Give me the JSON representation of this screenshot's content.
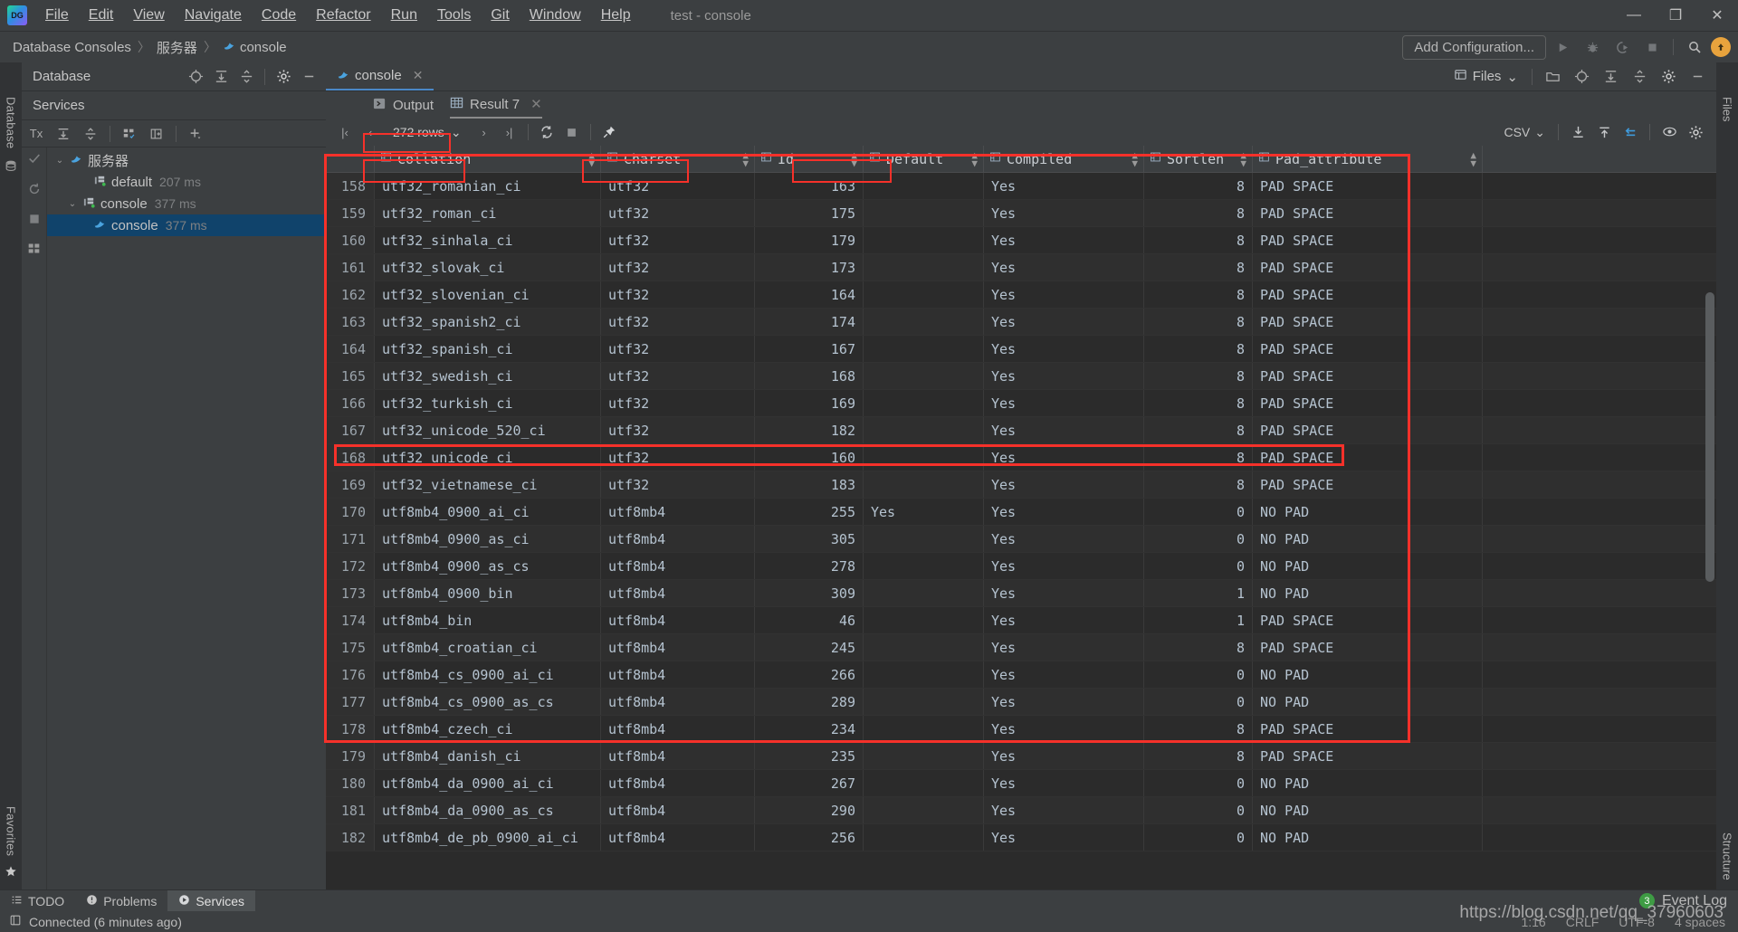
{
  "app": {
    "logo_text": "DG",
    "window_title": "test - console"
  },
  "menu": [
    {
      "label": "File"
    },
    {
      "label": "Edit"
    },
    {
      "label": "View"
    },
    {
      "label": "Navigate"
    },
    {
      "label": "Code"
    },
    {
      "label": "Refactor"
    },
    {
      "label": "Run"
    },
    {
      "label": "Tools"
    },
    {
      "label": "Git"
    },
    {
      "label": "Window"
    },
    {
      "label": "Help"
    }
  ],
  "window_controls": {
    "minimize": "—",
    "maximize": "❐",
    "close": "✕"
  },
  "breadcrumb": {
    "items": [
      {
        "label": "Database Consoles",
        "icon": ""
      },
      {
        "label": "服务器",
        "icon": ""
      },
      {
        "label": "console",
        "icon": "dolphin-icon"
      }
    ],
    "separator": "〉"
  },
  "run_toolbar": {
    "add_configuration": "Add Configuration...",
    "icons": [
      "run-icon",
      "debug-icon",
      "run-with-coverage-icon",
      "stop-icon",
      "search-icon",
      "update-icon"
    ]
  },
  "left_rail": {
    "label": "Database",
    "icon": "database-icon",
    "bottom_label": "Favorites",
    "bottom_icon": "star-icon"
  },
  "database_panel": {
    "title": "Database",
    "icons": [
      "locate-icon",
      "expand-all-icon",
      "collapse-all-icon",
      "settings-icon",
      "hide-icon"
    ]
  },
  "services_panel": {
    "title": "Services",
    "icons": [
      "settings-icon",
      "hide-icon"
    ],
    "toolbar": [
      "Tx",
      "expand-all-icon",
      "collapse-all-icon",
      "group-icon",
      "new-tab-icon",
      "add-icon"
    ],
    "gutter_icons": [
      "commit-icon",
      "rollback-icon",
      "stop-icon",
      "grid-icon"
    ]
  },
  "tree": [
    {
      "label": "服务器",
      "ms": "",
      "indent": 0,
      "chevron": "⌄",
      "icon": "dolphin-icon",
      "selected": false
    },
    {
      "label": "default",
      "ms": "207 ms",
      "indent": 1,
      "chevron": "",
      "icon": "console-icon",
      "selected": false
    },
    {
      "label": "console",
      "ms": "377 ms",
      "indent": 1,
      "chevron": "⌄",
      "icon": "console-icon",
      "selected": false
    },
    {
      "label": "console",
      "ms": "377 ms",
      "indent": 2,
      "chevron": "",
      "icon": "dolphin-icon",
      "selected": true
    }
  ],
  "editor": {
    "tab": {
      "label": "console",
      "icon": "dolphin-icon",
      "close": "✕"
    },
    "files_chip": {
      "label": "Files",
      "icon": "files-icon",
      "chevron": "⌄"
    },
    "right_icons": [
      "open-folder-icon",
      "locate-icon",
      "expand-icon",
      "collapse-icon",
      "settings-icon",
      "hide-icon"
    ]
  },
  "result_tabs": [
    {
      "label": "Output",
      "icon": "output-icon",
      "active": false,
      "closable": false
    },
    {
      "label": "Result 7",
      "icon": "table-icon",
      "active": true,
      "closable": true,
      "close": "✕"
    }
  ],
  "grid_toolbar": {
    "first_page": "|‹",
    "prev_page": "‹",
    "rows_label": "272 rows",
    "rows_chevron": "⌄",
    "next_page": "›",
    "last_page": "›|",
    "reload_icon": "refresh-icon",
    "stop_icon": "stop-icon",
    "pin_icon": "pin-icon",
    "format": "CSV",
    "format_chevron": "⌄",
    "right_icons": [
      "download-icon",
      "upload-icon",
      "transpose-icon",
      "view-icon",
      "settings-icon"
    ]
  },
  "grid": {
    "columns": [
      {
        "name": "Collation",
        "icon": "column-icon",
        "sortable": true,
        "width_class": "w-coll",
        "align": "left"
      },
      {
        "name": "Charset",
        "icon": "column-icon",
        "sortable": true,
        "width_class": "w-char",
        "align": "left"
      },
      {
        "name": "Id",
        "icon": "column-icon",
        "sortable": true,
        "width_class": "w-id",
        "align": "left"
      },
      {
        "name": "Default",
        "icon": "column-icon",
        "sortable": true,
        "width_class": "w-def",
        "align": "left"
      },
      {
        "name": "Compiled",
        "icon": "column-icon",
        "sortable": true,
        "width_class": "w-comp",
        "align": "left"
      },
      {
        "name": "Sortlen",
        "icon": "column-icon",
        "sortable": true,
        "width_class": "w-sort",
        "align": "left"
      },
      {
        "name": "Pad_attribute",
        "icon": "column-icon",
        "sortable": true,
        "width_class": "w-pad",
        "align": "left"
      }
    ],
    "rows": [
      {
        "n": "158",
        "collation": "utf32_romanian_ci",
        "charset": "utf32",
        "id": "163",
        "default": "",
        "compiled": "Yes",
        "sortlen": "8",
        "pad": "PAD SPACE",
        "highlight": false
      },
      {
        "n": "159",
        "collation": "utf32_roman_ci",
        "charset": "utf32",
        "id": "175",
        "default": "",
        "compiled": "Yes",
        "sortlen": "8",
        "pad": "PAD SPACE",
        "highlight": false
      },
      {
        "n": "160",
        "collation": "utf32_sinhala_ci",
        "charset": "utf32",
        "id": "179",
        "default": "",
        "compiled": "Yes",
        "sortlen": "8",
        "pad": "PAD SPACE",
        "highlight": false
      },
      {
        "n": "161",
        "collation": "utf32_slovak_ci",
        "charset": "utf32",
        "id": "173",
        "default": "",
        "compiled": "Yes",
        "sortlen": "8",
        "pad": "PAD SPACE",
        "highlight": false
      },
      {
        "n": "162",
        "collation": "utf32_slovenian_ci",
        "charset": "utf32",
        "id": "164",
        "default": "",
        "compiled": "Yes",
        "sortlen": "8",
        "pad": "PAD SPACE",
        "highlight": false
      },
      {
        "n": "163",
        "collation": "utf32_spanish2_ci",
        "charset": "utf32",
        "id": "174",
        "default": "",
        "compiled": "Yes",
        "sortlen": "8",
        "pad": "PAD SPACE",
        "highlight": false
      },
      {
        "n": "164",
        "collation": "utf32_spanish_ci",
        "charset": "utf32",
        "id": "167",
        "default": "",
        "compiled": "Yes",
        "sortlen": "8",
        "pad": "PAD SPACE",
        "highlight": false
      },
      {
        "n": "165",
        "collation": "utf32_swedish_ci",
        "charset": "utf32",
        "id": "168",
        "default": "",
        "compiled": "Yes",
        "sortlen": "8",
        "pad": "PAD SPACE",
        "highlight": false
      },
      {
        "n": "166",
        "collation": "utf32_turkish_ci",
        "charset": "utf32",
        "id": "169",
        "default": "",
        "compiled": "Yes",
        "sortlen": "8",
        "pad": "PAD SPACE",
        "highlight": false
      },
      {
        "n": "167",
        "collation": "utf32_unicode_520_ci",
        "charset": "utf32",
        "id": "182",
        "default": "",
        "compiled": "Yes",
        "sortlen": "8",
        "pad": "PAD SPACE",
        "highlight": false
      },
      {
        "n": "168",
        "collation": "utf32_unicode_ci",
        "charset": "utf32",
        "id": "160",
        "default": "",
        "compiled": "Yes",
        "sortlen": "8",
        "pad": "PAD SPACE",
        "highlight": false
      },
      {
        "n": "169",
        "collation": "utf32_vietnamese_ci",
        "charset": "utf32",
        "id": "183",
        "default": "",
        "compiled": "Yes",
        "sortlen": "8",
        "pad": "PAD SPACE",
        "highlight": false
      },
      {
        "n": "170",
        "collation": "utf8mb4_0900_ai_ci",
        "charset": "utf8mb4",
        "id": "255",
        "default": "Yes",
        "compiled": "Yes",
        "sortlen": "0",
        "pad": "NO PAD",
        "highlight": true
      },
      {
        "n": "171",
        "collation": "utf8mb4_0900_as_ci",
        "charset": "utf8mb4",
        "id": "305",
        "default": "",
        "compiled": "Yes",
        "sortlen": "0",
        "pad": "NO PAD",
        "highlight": false
      },
      {
        "n": "172",
        "collation": "utf8mb4_0900_as_cs",
        "charset": "utf8mb4",
        "id": "278",
        "default": "",
        "compiled": "Yes",
        "sortlen": "0",
        "pad": "NO PAD",
        "highlight": false
      },
      {
        "n": "173",
        "collation": "utf8mb4_0900_bin",
        "charset": "utf8mb4",
        "id": "309",
        "default": "",
        "compiled": "Yes",
        "sortlen": "1",
        "pad": "NO PAD",
        "highlight": false
      },
      {
        "n": "174",
        "collation": "utf8mb4_bin",
        "charset": "utf8mb4",
        "id": "46",
        "default": "",
        "compiled": "Yes",
        "sortlen": "1",
        "pad": "PAD SPACE",
        "highlight": false
      },
      {
        "n": "175",
        "collation": "utf8mb4_croatian_ci",
        "charset": "utf8mb4",
        "id": "245",
        "default": "",
        "compiled": "Yes",
        "sortlen": "8",
        "pad": "PAD SPACE",
        "highlight": false
      },
      {
        "n": "176",
        "collation": "utf8mb4_cs_0900_ai_ci",
        "charset": "utf8mb4",
        "id": "266",
        "default": "",
        "compiled": "Yes",
        "sortlen": "0",
        "pad": "NO PAD",
        "highlight": false
      },
      {
        "n": "177",
        "collation": "utf8mb4_cs_0900_as_cs",
        "charset": "utf8mb4",
        "id": "289",
        "default": "",
        "compiled": "Yes",
        "sortlen": "0",
        "pad": "NO PAD",
        "highlight": false
      },
      {
        "n": "178",
        "collation": "utf8mb4_czech_ci",
        "charset": "utf8mb4",
        "id": "234",
        "default": "",
        "compiled": "Yes",
        "sortlen": "8",
        "pad": "PAD SPACE",
        "highlight": false
      },
      {
        "n": "179",
        "collation": "utf8mb4_danish_ci",
        "charset": "utf8mb4",
        "id": "235",
        "default": "",
        "compiled": "Yes",
        "sortlen": "8",
        "pad": "PAD SPACE",
        "highlight": false
      },
      {
        "n": "180",
        "collation": "utf8mb4_da_0900_ai_ci",
        "charset": "utf8mb4",
        "id": "267",
        "default": "",
        "compiled": "Yes",
        "sortlen": "0",
        "pad": "NO PAD",
        "highlight": false
      },
      {
        "n": "181",
        "collation": "utf8mb4_da_0900_as_cs",
        "charset": "utf8mb4",
        "id": "290",
        "default": "",
        "compiled": "Yes",
        "sortlen": "0",
        "pad": "NO PAD",
        "highlight": false
      },
      {
        "n": "182",
        "collation": "utf8mb4_de_pb_0900_ai_ci",
        "charset": "utf8mb4",
        "id": "256",
        "default": "",
        "compiled": "Yes",
        "sortlen": "0",
        "pad": "NO PAD",
        "highlight": false
      }
    ]
  },
  "right_rail": {
    "top_label": "Files",
    "bottom_label": "Structure"
  },
  "status_bar": {
    "tabs": [
      {
        "label": "TODO",
        "icon": "todo-icon",
        "active": false
      },
      {
        "label": "Problems",
        "icon": "problems-icon",
        "active": false
      },
      {
        "label": "Services",
        "icon": "services-icon",
        "active": true
      }
    ],
    "event_log": {
      "label": "Event Log",
      "count": "3"
    },
    "connection": "Connected (6 minutes ago)",
    "connection_icon": "db-icon",
    "caret": "1:16",
    "line_sep": "CRLF",
    "encoding": "UTF-8",
    "indent": "4 spaces"
  },
  "watermark": "https://blog.csdn.net/qq_37960603",
  "colors": {
    "accent_red": "#f6312a",
    "selection_blue": "#10436b",
    "tab_underline": "#4a88c7",
    "badge_green": "#3e9c44",
    "orange": "#e8a33d"
  }
}
